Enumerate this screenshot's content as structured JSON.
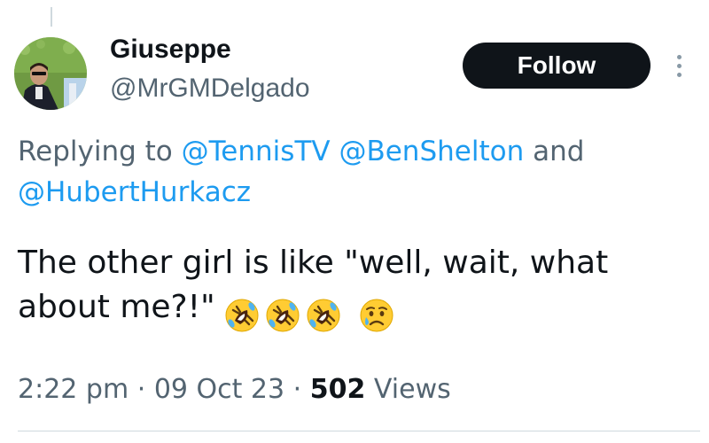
{
  "author": {
    "display_name": "Giuseppe",
    "handle": "@MrGMDelgado"
  },
  "header": {
    "follow_label": "Follow"
  },
  "reply_context": {
    "prefix": "Replying to",
    "mentions": [
      "@TennisTV",
      "@BenShelton",
      "@HubertHurkacz"
    ],
    "conjunction": "and"
  },
  "tweet": {
    "text": "The other girl is like \"well, wait, what about me?!\"",
    "emojis": [
      "rolling-on-floor-laughing-emoji",
      "rolling-on-floor-laughing-emoji",
      "rolling-on-floor-laughing-emoji",
      "sad-but-relieved-face-emoji"
    ]
  },
  "meta": {
    "time": "2:22 pm",
    "separator": "·",
    "date": "09 Oct 23",
    "views_count": "502",
    "views_label": "Views"
  },
  "colors": {
    "link": "#1d9bf0",
    "secondary_text": "#536471",
    "primary_text": "#0f1419",
    "follow_bg": "#0f1419"
  },
  "icons": {
    "more": "more-vertical-icon",
    "avatar": "user-avatar"
  }
}
